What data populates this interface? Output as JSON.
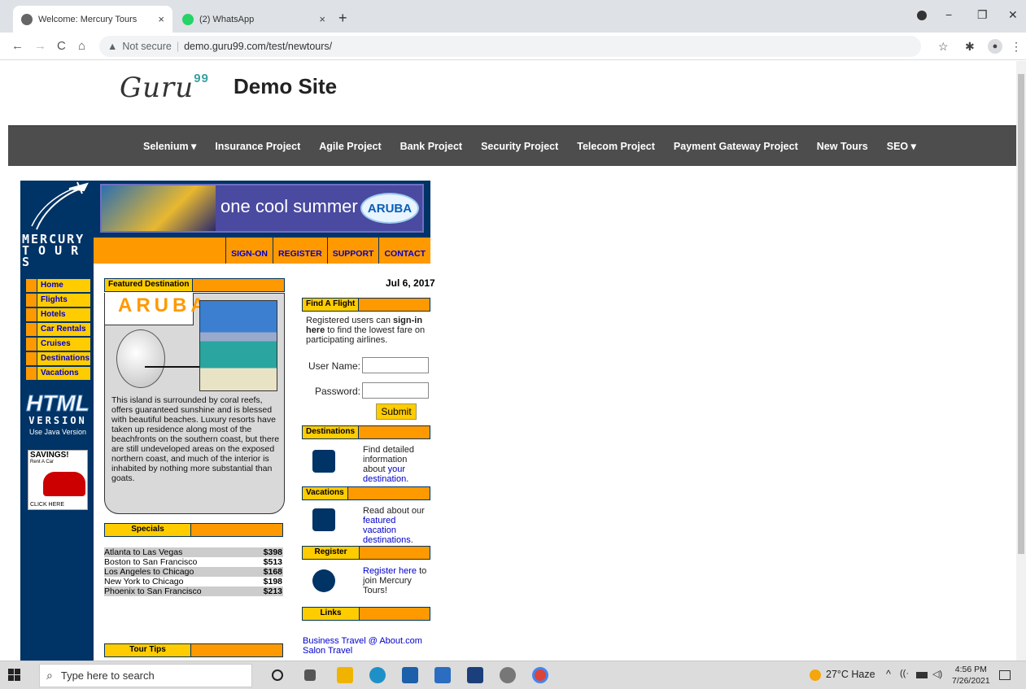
{
  "browser": {
    "tabs": [
      {
        "title": "Welcome: Mercury Tours",
        "close": "×"
      },
      {
        "title": "(2) WhatsApp",
        "close": "×"
      }
    ],
    "new_tab": "+",
    "window_controls": {
      "minimize": "−",
      "maximize": "❐",
      "close": "✕"
    },
    "nav": {
      "back": "←",
      "forward": "→",
      "reload": "C",
      "home": "⌂"
    },
    "security": "Not secure",
    "url": "demo.guru99.com/test/newtours/",
    "icons": {
      "bookmark": "☆",
      "extensions": "✱",
      "profile": "●",
      "menu": "⋮"
    }
  },
  "site": {
    "logo": "Guru",
    "logo_sup": "99",
    "title": "Demo Site",
    "nav": [
      "Selenium ▾",
      "Insurance Project",
      "Agile Project",
      "Bank Project",
      "Security Project",
      "Telecom Project",
      "Payment Gateway Project",
      "New Tours",
      "SEO ▾"
    ]
  },
  "mercury": {
    "logo_line1": "MERCURY",
    "logo_line2": "T O U R S",
    "banner_text": "one cool summer",
    "banner_badge": "ARUBA",
    "top_menu": [
      "SIGN-ON",
      "REGISTER",
      "SUPPORT",
      "CONTACT"
    ],
    "left_nav": [
      "Home",
      "Flights",
      "Hotels",
      "Car Rentals",
      "Cruises",
      "Destinations",
      "Vacations"
    ],
    "html_version": {
      "big": "HTML",
      "small": "VERSION",
      "link": "Use Java Version"
    },
    "savings": {
      "title": "SAVINGS!",
      "sub": "Rent A Car",
      "cta": "CLICK HERE"
    },
    "featured": {
      "header": "Featured Destination",
      "name": "ARUBA",
      "text": "This island is surrounded by coral reefs, offers guaranteed sunshine and is blessed with beautiful beaches. Luxury resorts have taken up residence along most of the beachfronts on the southern coast, but there are still undeveloped areas on the exposed northern coast, and much of the interior is inhabited by nothing more substantial than goats."
    },
    "specials": {
      "header": "Specials",
      "rows": [
        {
          "route": "Atlanta to Las Vegas",
          "price": "$398"
        },
        {
          "route": "Boston to San Francisco",
          "price": "$513"
        },
        {
          "route": "Los Angeles to Chicago",
          "price": "$168"
        },
        {
          "route": "New York to Chicago",
          "price": "$198"
        },
        {
          "route": "Phoenix to San Francisco",
          "price": "$213"
        }
      ]
    },
    "tour_tips": "Tour Tips",
    "date": "Jul 6, 2017",
    "find_flight": {
      "header": "Find A Flight",
      "text_a": "Registered users can ",
      "text_b": "sign-in here",
      "text_c": " to find the lowest fare on participating airlines.",
      "user_label": "User Name:",
      "pass_label": "Password:",
      "submit": "Submit"
    },
    "destinations": {
      "header": "Destinations",
      "text": "Find detailed information about",
      "link": "your destination",
      "tail": "."
    },
    "vacations": {
      "header": "Vacations",
      "text": "Read about our",
      "link": "featured vacation destinations",
      "tail": "."
    },
    "register": {
      "header": "Register",
      "link": "Register here",
      "text": " to join Mercury Tours!"
    },
    "links": {
      "header": "Links",
      "items": [
        "Business Travel @ About.com",
        "Salon Travel"
      ]
    }
  },
  "taskbar": {
    "search_placeholder": "Type here to search",
    "weather": "27°C  Haze",
    "time": "4:56 PM",
    "date": "7/26/2021"
  }
}
